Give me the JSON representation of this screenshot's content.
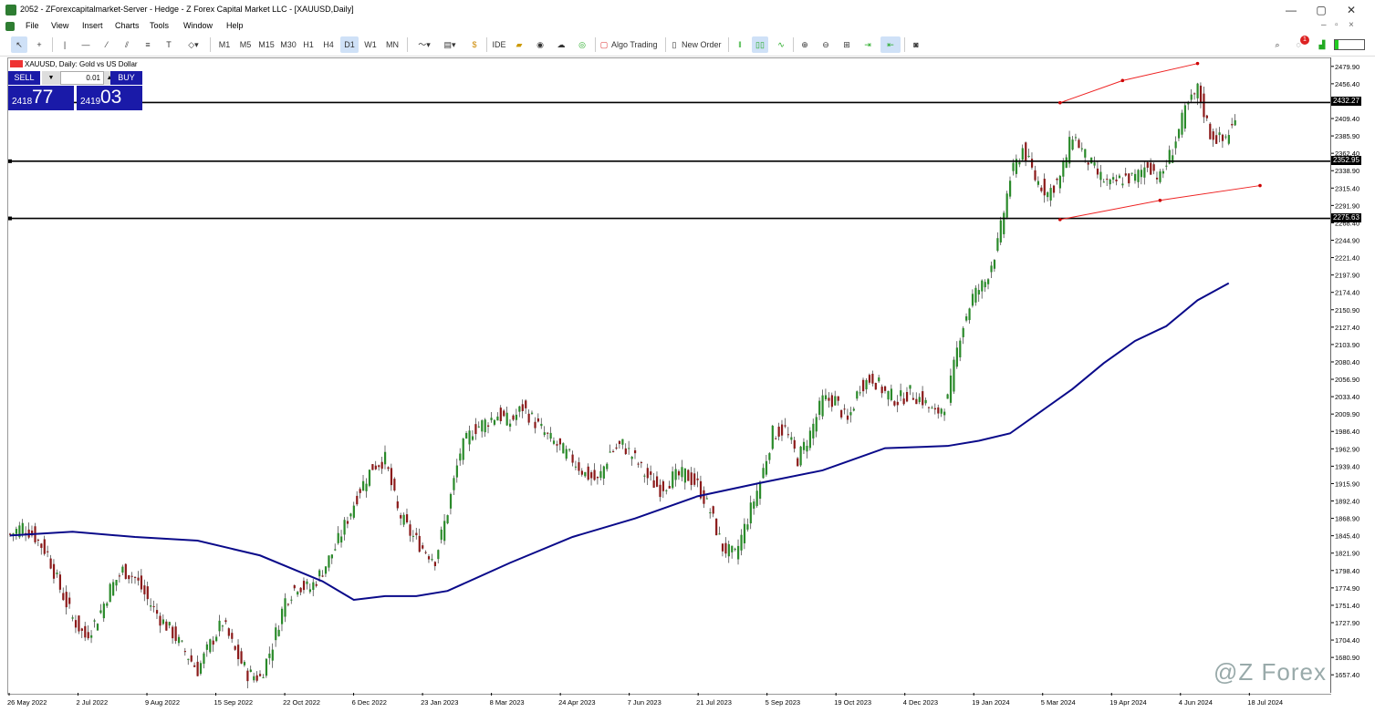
{
  "window": {
    "title": "2052 - ZForexcapitalmarket-Server - Hedge - Z Forex Capital Market LLC - [XAUUSD,Daily]",
    "controls": [
      "—",
      "▢",
      "✕"
    ],
    "mdi_controls": [
      "–",
      "▫",
      "×"
    ]
  },
  "menu": [
    "File",
    "View",
    "Insert",
    "Charts",
    "Tools",
    "Window",
    "Help"
  ],
  "toolbar": {
    "timeframes": [
      "M1",
      "M5",
      "M15",
      "M30",
      "H1",
      "H4",
      "D1",
      "W1",
      "MN"
    ],
    "active_timeframe": "D1",
    "ide": "IDE",
    "algo_trading": "Algo Trading",
    "new_order": "New Order",
    "notification_count": "1"
  },
  "chart": {
    "symbol_label": "XAUUSD, Daily:  Gold vs US Dollar",
    "trade_panel": {
      "sell_label": "SELL",
      "buy_label": "BUY",
      "lot": "0.01",
      "sell_small": "2418",
      "sell_big": "77",
      "buy_small": "2419",
      "buy_big": "03"
    },
    "watermark": "@Z Forex"
  },
  "chart_data": {
    "type": "line",
    "title": "XAUUSD, Daily",
    "ylim": [
      1633,
      2492
    ],
    "price_ticks": [
      "2479.90",
      "2456.40",
      "2432.90",
      "2409.40",
      "2385.90",
      "2362.40",
      "2338.90",
      "2315.40",
      "2291.90",
      "2268.40",
      "2244.90",
      "2221.40",
      "2197.90",
      "2174.40",
      "2150.90",
      "2127.40",
      "2103.90",
      "2080.40",
      "2056.90",
      "2033.40",
      "2009.90",
      "1986.40",
      "1962.90",
      "1939.40",
      "1915.90",
      "1892.40",
      "1868.90",
      "1845.40",
      "1821.90",
      "1798.40",
      "1774.90",
      "1751.40",
      "1727.90",
      "1704.40",
      "1680.90",
      "1657.40"
    ],
    "time_ticks": [
      "26 May 2022",
      "2 Jul 2022",
      "9 Aug 2022",
      "15 Sep 2022",
      "22 Oct 2022",
      "6 Dec 2022",
      "23 Jan 2023",
      "8 Mar 2023",
      "24 Apr 2023",
      "7 Jun 2023",
      "21 Jul 2023",
      "5 Sep 2023",
      "19 Oct 2023",
      "4 Dec 2023",
      "19 Jan 2024",
      "5 Mar 2024",
      "19 Apr 2024",
      "4 Jun 2024",
      "18 Jul 2024"
    ],
    "horizontal_levels": [
      "2432.27",
      "2352.95",
      "2275.63"
    ],
    "price_path": [
      [
        0,
        1848
      ],
      [
        2,
        1860
      ],
      [
        4,
        1845
      ],
      [
        6,
        1822
      ],
      [
        8,
        1775
      ],
      [
        10,
        1735
      ],
      [
        12,
        1710
      ],
      [
        14,
        1735
      ],
      [
        16,
        1775
      ],
      [
        18,
        1800
      ],
      [
        20,
        1790
      ],
      [
        22,
        1760
      ],
      [
        24,
        1735
      ],
      [
        26,
        1715
      ],
      [
        28,
        1690
      ],
      [
        30,
        1665
      ],
      [
        32,
        1700
      ],
      [
        34,
        1730
      ],
      [
        36,
        1690
      ],
      [
        38,
        1660
      ],
      [
        40,
        1655
      ],
      [
        42,
        1700
      ],
      [
        44,
        1760
      ],
      [
        46,
        1780
      ],
      [
        48,
        1775
      ],
      [
        50,
        1800
      ],
      [
        52,
        1830
      ],
      [
        54,
        1870
      ],
      [
        56,
        1910
      ],
      [
        58,
        1940
      ],
      [
        60,
        1950
      ],
      [
        62,
        1880
      ],
      [
        64,
        1850
      ],
      [
        66,
        1830
      ],
      [
        68,
        1815
      ],
      [
        70,
        1880
      ],
      [
        72,
        1960
      ],
      [
        74,
        1990
      ],
      [
        76,
        2000
      ],
      [
        78,
        2010
      ],
      [
        80,
        2000
      ],
      [
        82,
        2020
      ],
      [
        84,
        2000
      ],
      [
        86,
        1980
      ],
      [
        88,
        1965
      ],
      [
        90,
        1950
      ],
      [
        92,
        1930
      ],
      [
        94,
        1920
      ],
      [
        96,
        1960
      ],
      [
        98,
        1970
      ],
      [
        100,
        1950
      ],
      [
        102,
        1925
      ],
      [
        104,
        1910
      ],
      [
        106,
        1925
      ],
      [
        108,
        1930
      ],
      [
        110,
        1915
      ],
      [
        112,
        1880
      ],
      [
        114,
        1830
      ],
      [
        116,
        1820
      ],
      [
        118,
        1870
      ],
      [
        120,
        1920
      ],
      [
        122,
        1985
      ],
      [
        124,
        1990
      ],
      [
        126,
        1950
      ],
      [
        128,
        1985
      ],
      [
        130,
        2030
      ],
      [
        132,
        2030
      ],
      [
        134,
        2000
      ],
      [
        136,
        2050
      ],
      [
        138,
        2060
      ],
      [
        140,
        2040
      ],
      [
        142,
        2030
      ],
      [
        144,
        2040
      ],
      [
        146,
        2030
      ],
      [
        148,
        2010
      ],
      [
        150,
        2030
      ],
      [
        152,
        2120
      ],
      [
        154,
        2170
      ],
      [
        156,
        2190
      ],
      [
        158,
        2240
      ],
      [
        160,
        2330
      ],
      [
        162,
        2370
      ],
      [
        164,
        2330
      ],
      [
        166,
        2310
      ],
      [
        168,
        2330
      ],
      [
        170,
        2390
      ],
      [
        172,
        2360
      ],
      [
        174,
        2335
      ],
      [
        176,
        2320
      ],
      [
        178,
        2330
      ],
      [
        180,
        2330
      ],
      [
        182,
        2350
      ],
      [
        184,
        2330
      ],
      [
        186,
        2370
      ],
      [
        188,
        2420
      ],
      [
        190,
        2450
      ],
      [
        192,
        2390
      ],
      [
        194,
        2380
      ],
      [
        196,
        2405
      ]
    ],
    "ma_path": [
      [
        0,
        1847
      ],
      [
        10,
        1852
      ],
      [
        20,
        1845
      ],
      [
        30,
        1840
      ],
      [
        40,
        1820
      ],
      [
        50,
        1785
      ],
      [
        55,
        1760
      ],
      [
        60,
        1765
      ],
      [
        65,
        1765
      ],
      [
        70,
        1772
      ],
      [
        80,
        1810
      ],
      [
        90,
        1845
      ],
      [
        100,
        1870
      ],
      [
        110,
        1900
      ],
      [
        120,
        1918
      ],
      [
        130,
        1935
      ],
      [
        140,
        1965
      ],
      [
        150,
        1968
      ],
      [
        155,
        1975
      ],
      [
        160,
        1985
      ],
      [
        165,
        2015
      ],
      [
        170,
        2045
      ],
      [
        175,
        2080
      ],
      [
        180,
        2110
      ],
      [
        185,
        2130
      ],
      [
        190,
        2165
      ],
      [
        195,
        2188
      ]
    ],
    "channel_upper": [
      [
        168,
        2432
      ],
      [
        178,
        2462
      ],
      [
        190,
        2485
      ]
    ],
    "channel_lower": [
      [
        168,
        2274
      ],
      [
        184,
        2300
      ],
      [
        200,
        2320
      ]
    ],
    "grid": false
  }
}
